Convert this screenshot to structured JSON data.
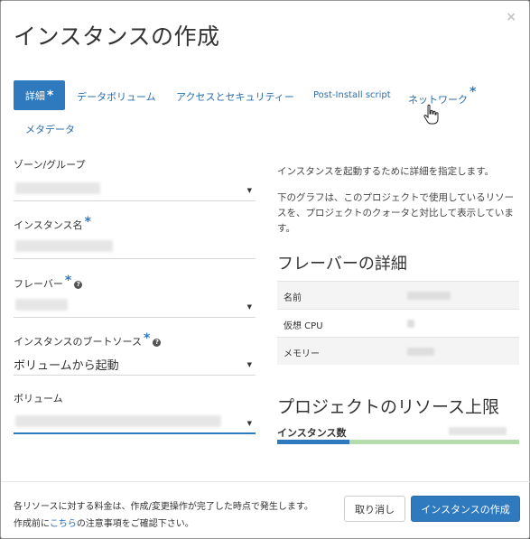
{
  "dialog": {
    "title": "インスタンスの作成",
    "close_label": "×"
  },
  "tabs": [
    {
      "label": "詳細",
      "required": true,
      "active": true
    },
    {
      "label": "データボリューム",
      "required": false,
      "active": false
    },
    {
      "label": "アクセスとセキュリティー",
      "required": false,
      "active": false
    },
    {
      "label": "Post-Install script",
      "required": false,
      "active": false
    },
    {
      "label": "ネットワーク",
      "required": true,
      "active": false
    },
    {
      "label": "メタデータ",
      "required": false,
      "active": false
    }
  ],
  "fields": {
    "zone": {
      "label": "ゾーン/グループ"
    },
    "instance_name": {
      "label": "インスタンス名"
    },
    "flavor": {
      "label": "フレーバー"
    },
    "boot_source": {
      "label": "インスタンスのブートソース",
      "value": "ボリュームから起動"
    },
    "volume": {
      "label": "ボリューム"
    }
  },
  "required_mark": "*",
  "help_mark": "?",
  "description": {
    "p1": "インスタンスを起動するために詳細を指定します。",
    "p2": "下のグラフは、このプロジェクトで使用しているリソースを、プロジェクトのクォータと対比して表示しています。"
  },
  "flavor_details": {
    "heading": "フレーバーの詳細",
    "rows": [
      {
        "key": "名前"
      },
      {
        "key": "仮想 CPU"
      },
      {
        "key": "メモリー"
      }
    ]
  },
  "quota": {
    "heading": "プロジェクトのリソース上限",
    "instances_label": "インスタンス数",
    "used_fraction": 0.3
  },
  "footer": {
    "note_line1": "各リソースに対する料金は、作成/変更操作が完了した時点で発生します。",
    "note_line2_prefix": "作成前に",
    "note_link": "こちら",
    "note_line2_suffix": "の注意事項をご確認下さい。",
    "cancel_label": "取り消し",
    "submit_label": "インスタンスの作成"
  },
  "colors": {
    "primary": "#2f79bf",
    "quota_remaining": "#b6dcae"
  }
}
